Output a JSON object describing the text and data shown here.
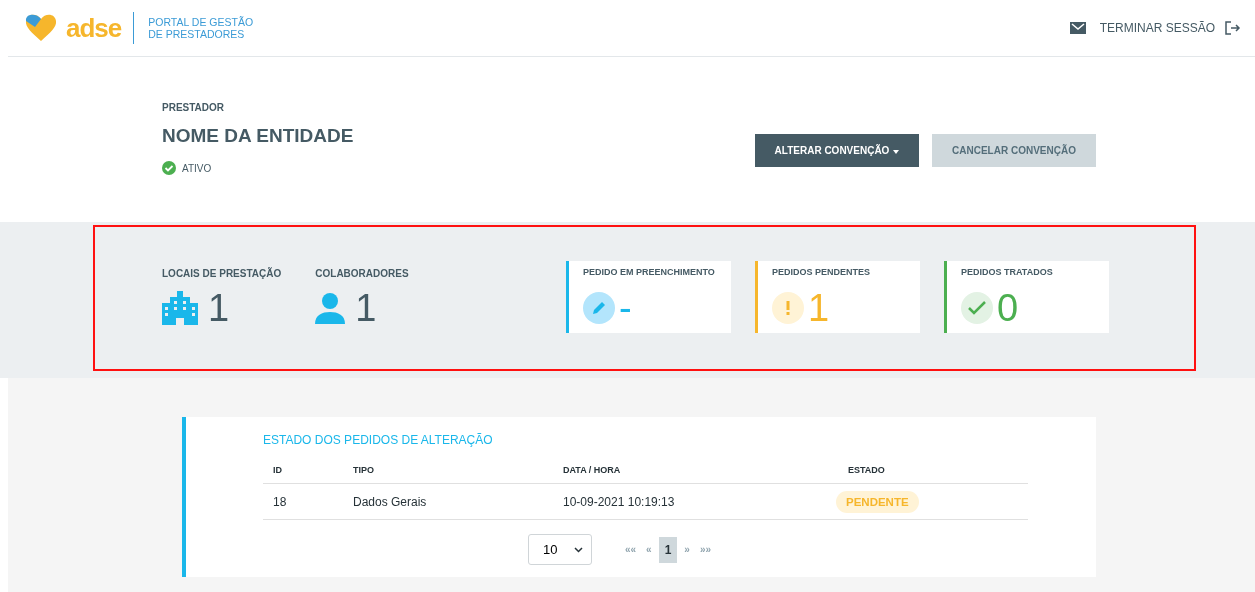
{
  "header": {
    "logo_text": "adse",
    "portal_title": [
      "PORTAL DE GESTÃO",
      "DE PRESTADORES"
    ],
    "logout": "TERMINAR SESSÃO"
  },
  "provider": {
    "label": "PRESTADOR",
    "name": "NOME DA ENTIDADE",
    "status": "ATIVO",
    "active": true,
    "buttons": [
      {
        "label": "ALTERAR CONVENÇÃO",
        "kind": "dropdown"
      },
      {
        "label": "CANCELAR CONVENÇÃO",
        "kind": "secondary"
      }
    ]
  },
  "stats": {
    "highlighted": true,
    "counters": [
      {
        "label": "LOCAIS DE PRESTAÇÃO",
        "value": "1",
        "kind": "building"
      },
      {
        "label": "COLABORADORES",
        "value": "1",
        "kind": "person"
      }
    ],
    "cards": [
      {
        "label": "PEDIDO EM PREENCHIMENTO",
        "value": "-",
        "kind": "editing",
        "color": "#1ab7ea"
      },
      {
        "label": "PEDIDOS PENDENTES",
        "value": "1",
        "kind": "pending",
        "color": "#f6b62c"
      },
      {
        "label": "PEDIDOS TRATADOS",
        "value": "0",
        "kind": "done",
        "color": "#4caf50"
      }
    ]
  },
  "requests": {
    "title": "ESTADO DOS PEDIDOS DE ALTERAÇÃO",
    "columns": [
      "ID",
      "TIPO",
      "DATA / HORA",
      "ESTADO"
    ],
    "rows": [
      {
        "id": "18",
        "type": "Dados Gerais",
        "datetime": "10-09-2021 10:19:13",
        "status": "PENDENTE"
      }
    ],
    "page_size": "10",
    "pager": [
      {
        "label": "««",
        "selected": false
      },
      {
        "label": "«",
        "selected": false
      },
      {
        "label": "1",
        "selected": true
      },
      {
        "label": "»",
        "selected": false
      },
      {
        "label": "»»",
        "selected": false
      }
    ]
  }
}
